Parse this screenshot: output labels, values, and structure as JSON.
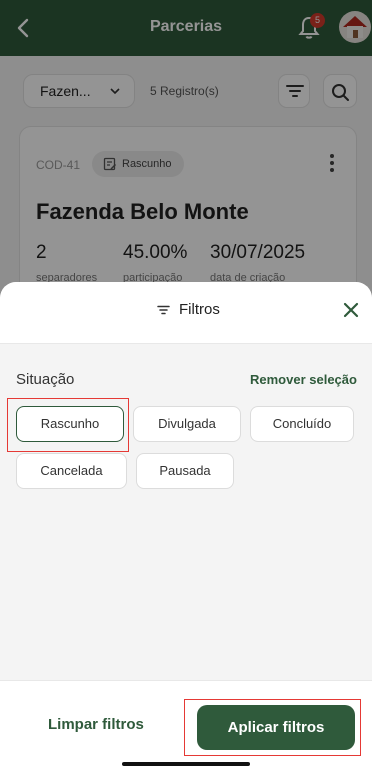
{
  "appbar": {
    "title": "Parcerias",
    "notification_count": "5"
  },
  "toolbar": {
    "farm_select": "Fazen...",
    "records": "5 Registro(s)"
  },
  "card": {
    "code": "COD-41",
    "status": "Rascunho",
    "title": "Fazenda Belo Monte",
    "stats": [
      {
        "value": "2",
        "label": "separadores"
      },
      {
        "value": "45.00%",
        "label": "participação"
      },
      {
        "value": "30/07/2025",
        "label": "data de criação"
      }
    ]
  },
  "sheet": {
    "title": "Filtros",
    "section_label": "Situação",
    "remove_selection": "Remover seleção",
    "chips": [
      "Rascunho",
      "Divulgada",
      "Concluído",
      "Cancelada",
      "Pausada"
    ],
    "selected_chip": "Rascunho",
    "clear_label": "Limpar filtros",
    "apply_label": "Aplicar filtros"
  },
  "colors": {
    "brand_green": "#2f5a3b",
    "highlight_red": "#e53935",
    "badge_red": "#d23a2c"
  },
  "icons": [
    "back-arrow-icon",
    "bell-icon",
    "avatar-house-icon",
    "chevron-down-icon",
    "filter-lines-icon",
    "search-icon",
    "edit-document-icon",
    "kebab-menu-icon",
    "close-icon"
  ]
}
